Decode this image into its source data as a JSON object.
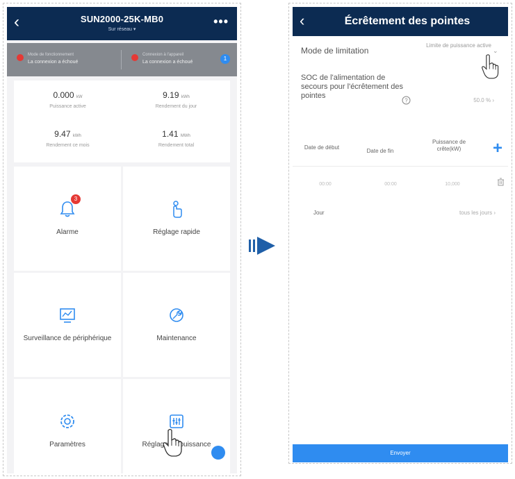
{
  "left_screen": {
    "header": {
      "back_icon": "back-chevron-icon",
      "title": "SUN2000-25K-MB0",
      "subtitle": "Sur réseau",
      "more_icon": "more-dots-icon"
    },
    "alarms": [
      {
        "label": "Mode de fonctionnement",
        "value": "La connexion a échoué"
      },
      {
        "label": "Connexion à l'appareil",
        "value": "La connexion a échoué"
      }
    ],
    "alarm_badge": "1",
    "stats": [
      {
        "value": "0.000",
        "unit": "kW",
        "label": "Puissance active"
      },
      {
        "value": "9.19",
        "unit": "kWh",
        "label": "Rendement du jour"
      },
      {
        "value": "9.47",
        "unit": "kWh",
        "label": "Rendement ce mois"
      },
      {
        "value": "1.41",
        "unit": "MWh",
        "label": "Rendement total"
      }
    ],
    "tiles": [
      {
        "label": "Alarme",
        "icon": "bell-icon",
        "badge": "3"
      },
      {
        "label": "Réglage rapide",
        "icon": "quick-setup-hand-icon"
      },
      {
        "label": "Surveillance de périphérique",
        "icon": "monitor-chart-icon"
      },
      {
        "label": "Maintenance",
        "icon": "maintenance-wrench-icon"
      },
      {
        "label": "Paramètres",
        "icon": "settings-gear-icon"
      },
      {
        "label": "Réglage de puissance",
        "icon": "power-adjust-icon"
      }
    ]
  },
  "right_screen": {
    "header": {
      "back_icon": "back-chevron-icon",
      "title": "Écrêtement des pointes"
    },
    "limitation_mode": {
      "label": "Mode de limitation",
      "value": "Limite de puissance active"
    },
    "soc": {
      "label": "SOC de l'alimentation de secours pour l'écrêtement des pointes",
      "value": "50.0 %"
    },
    "table": {
      "columns": [
        "Date de début",
        "Date de fin",
        "Puissance de crête(kW)"
      ],
      "rows": [
        {
          "start": "00:00",
          "end": "00:00",
          "peak": "10,000"
        }
      ]
    },
    "repeat": {
      "label": "Jour",
      "value": "tous les jours"
    },
    "submit_label": "Envoyer"
  },
  "colors": {
    "header_bg": "#0c2b52",
    "accent_blue": "#2f8cf0",
    "alarm_red": "#e53935",
    "alarm_bar_bg": "#85898f"
  }
}
